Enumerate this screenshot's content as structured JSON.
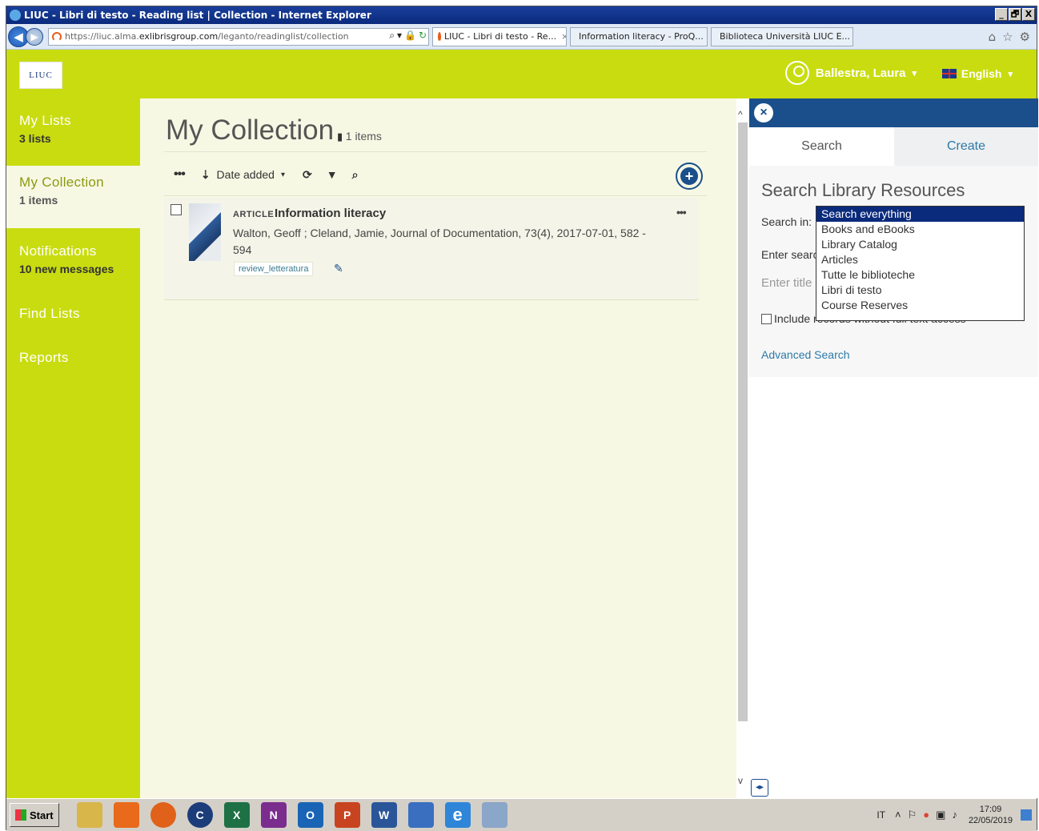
{
  "window": {
    "title": "LIUC - Libri di testo - Reading list | Collection - Internet Explorer",
    "controls": [
      "_",
      "🗗",
      "X"
    ]
  },
  "browser": {
    "url_host_prefix": "https://liuc.alma.",
    "url_host_main": "exlibrisgroup.com",
    "url_path": "/leganto/readinglist/collection",
    "tabs": [
      {
        "label": "LIUC - Libri di testo - Re...",
        "active": true,
        "color": "#e85b1b"
      },
      {
        "label": "Information literacy - ProQ...",
        "active": false,
        "color": "#3a7fd3"
      },
      {
        "label": "Biblioteca Università LIUC E...",
        "active": false,
        "color": "#2c5aa0"
      }
    ]
  },
  "header": {
    "logo_text": "LIUC",
    "user_name": "Ballestra, Laura",
    "user_caret": "▾",
    "language": "English",
    "language_caret": "▾"
  },
  "sidebar": {
    "items": [
      {
        "label": "My Lists",
        "sub": "3 lists"
      },
      {
        "label": "My Collection",
        "sub": "1 items"
      },
      {
        "label": "Notifications",
        "sub": "10 new messages"
      },
      {
        "label": "Find Lists",
        "sub": ""
      },
      {
        "label": "Reports",
        "sub": ""
      }
    ]
  },
  "main": {
    "title": "My Collection",
    "items_count": "1 items",
    "toolbar": {
      "more": "•••",
      "sort_icon": "⇣",
      "sort_label": "Date added",
      "sort_caret": "▾",
      "refresh": "⟳",
      "filter": "▼",
      "search": "⌕"
    },
    "add_symbol": "+",
    "item": {
      "type": "ARTICLE",
      "title": "Information literacy",
      "meta": "Walton, Geoff ; Cleland, Jamie, Journal of Documentation, 73(4), 2017-07-01, 582 - 594",
      "tag": "review_letteratura",
      "more": "•••"
    }
  },
  "scrollbar": {
    "up": "^",
    "down": "v"
  },
  "right_panel": {
    "close": "×",
    "tabs": {
      "search": "Search",
      "create": "Create"
    },
    "title": "Search Library Resources",
    "search_in_label": "Search in:",
    "enter_label": "Enter searc",
    "input_placeholder": "Enter title",
    "include_label": "Include records without full text access",
    "advanced": "Advanced Search",
    "dropdown_options": [
      "Search everything",
      "Books and eBooks",
      "Library Catalog",
      "Articles",
      "Tutte le biblioteche",
      "Libri di testo",
      "Course Reserves"
    ],
    "dropdown_selected": "Search everything",
    "expand_btn": "◂▸"
  },
  "taskbar": {
    "start": "Start",
    "apps": [
      {
        "name": "explorer-icon",
        "glyph": "",
        "color": "#d9b64a"
      },
      {
        "name": "media-icon",
        "glyph": "",
        "color": "#e86a1a"
      },
      {
        "name": "firefox-icon",
        "glyph": "",
        "color": "#e0621a"
      },
      {
        "name": "ccleaner-icon",
        "glyph": "C",
        "color": "#1b3d7a"
      },
      {
        "name": "excel-icon",
        "glyph": "X",
        "color": "#1e7145"
      },
      {
        "name": "onenote-icon",
        "glyph": "N",
        "color": "#7b2d8e"
      },
      {
        "name": "outlook-icon",
        "glyph": "O",
        "color": "#1a64b5"
      },
      {
        "name": "powerpoint-icon",
        "glyph": "P",
        "color": "#c8431f"
      },
      {
        "name": "word-icon",
        "glyph": "W",
        "color": "#2a5699"
      },
      {
        "name": "security-icon",
        "glyph": "",
        "color": "#3a6fc0"
      },
      {
        "name": "ie-icon",
        "glyph": "e",
        "color": "#2f86d8"
      },
      {
        "name": "note-icon",
        "glyph": "",
        "color": "#8aa6c8"
      }
    ],
    "lang": "IT",
    "time": "17:09",
    "date": "22/05/2019"
  }
}
